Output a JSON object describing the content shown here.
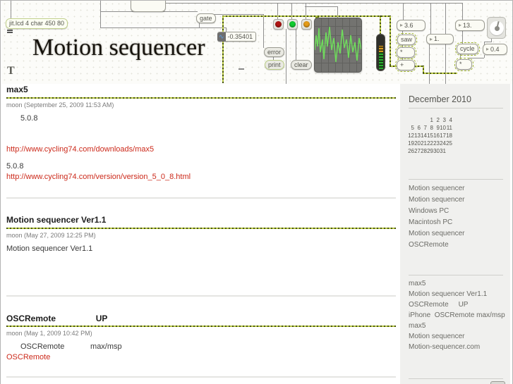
{
  "header": {
    "title": "Motion sequencer",
    "patch": {
      "jit_lcd": "jit.lcd 4 char 450 80",
      "gate": "gate",
      "signal_value": "-0.35401",
      "error": "error",
      "print": "print",
      "clear": "clear",
      "num_36": "3.6",
      "saw": "saw",
      "mult1": "*",
      "plus": "+",
      "num_1": "1.",
      "num_13": "13.",
      "cycle": "cycle",
      "num_04": "0.4",
      "mult2": "*",
      "toggle": "T",
      "leds": [
        {
          "name": "red-led",
          "color": "#b01512"
        },
        {
          "name": "green-led",
          "color": "#12cc2f"
        },
        {
          "name": "orange-led",
          "color": "#e59c18"
        }
      ],
      "colors": {
        "cord_dark": "#46520e",
        "cord_light": "#b7c743",
        "waveform": "#6fdc5c"
      }
    }
  },
  "posts": [
    {
      "title": "max5",
      "meta": "moon (September 25, 2009 11:53 AM)",
      "line1": "5.0.8",
      "link1": "http://www.cycling74.com/downloads/max5",
      "line2": "5.0.8",
      "link2": "http://www.cycling74.com/version/version_5_0_8.html"
    },
    {
      "title": "Motion sequencer Ver1.1",
      "meta": "moon (May 27, 2009 12:25 PM)",
      "body": "Motion sequencer Ver1.1"
    },
    {
      "title": "OSCRemote                 UP",
      "meta": "moon (May 1, 2009 10:42 PM)",
      "body_line1": "OSCRemote            max/msp",
      "link1": "OSCRemote"
    }
  ],
  "sidebar": {
    "calendar": {
      "title": "December 2010",
      "weeks": [
        [
          "",
          "",
          "",
          "1",
          "2",
          "3",
          "4"
        ],
        [
          "5",
          "6",
          "7",
          "8",
          "9",
          "10",
          "11"
        ],
        [
          "12",
          "13",
          "14",
          "15",
          "16",
          "17",
          "18"
        ],
        [
          "19",
          "20",
          "21",
          "22",
          "23",
          "24",
          "25"
        ],
        [
          "26",
          "27",
          "28",
          "29",
          "30",
          "31",
          ""
        ]
      ]
    },
    "categories": [
      "Motion sequencer",
      "Motion sequencer",
      "Windows PC",
      "Macintosh PC",
      "Motion sequencer",
      "OSCRemote"
    ],
    "recent": [
      "max5",
      "Motion sequencer Ver1.1",
      "OSCRemote     UP",
      "iPhone  OSCRemote max/msp",
      "max5",
      "Motion sequencer",
      "Motion-sequencer.com"
    ]
  }
}
